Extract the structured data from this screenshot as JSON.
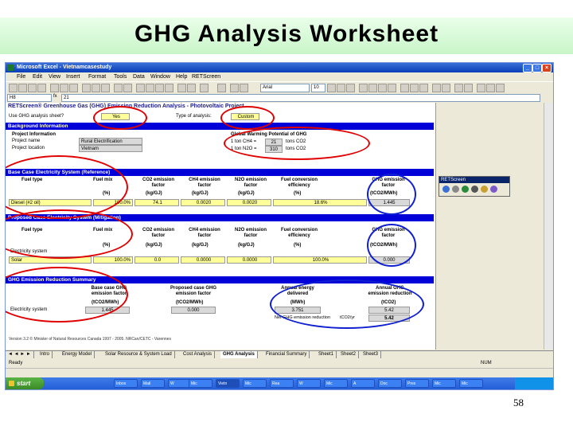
{
  "slide": {
    "title": "GHG Analysis Worksheet",
    "page_number": "58"
  },
  "window": {
    "title": "Microsoft Excel - Vietnamcasestudy"
  },
  "menu": [
    "File",
    "Edit",
    "View",
    "Insert",
    "Format",
    "Tools",
    "Data",
    "Window",
    "Help",
    "RETScreen"
  ],
  "toolbar": {
    "font_name": "Arial",
    "font_size": "10"
  },
  "formula_bar": {
    "name_box": "H8",
    "fx": "fx",
    "value": "21"
  },
  "header": {
    "title": "RETScreen® Greenhouse Gas (GHG) Emission Reduction Analysis - Photovoltaic Project"
  },
  "top_row": {
    "use_label": "Use GHG analysis sheet?",
    "use_value": "Yes",
    "type_label": "Type of analysis:",
    "type_value": "Custom"
  },
  "background": {
    "bar": "Background Information",
    "project_information": "Project Information",
    "project_name_label": "Project name",
    "project_name": "Rural Electrification",
    "project_location_label": "Project location",
    "project_location": "Vietnam",
    "gwp_title": "Global Warming Potential of GHG",
    "gwp_rows": [
      {
        "prefix": "1 ton CH4 =",
        "value": "21",
        "suffix": "tons CO2"
      },
      {
        "prefix": "1 ton N2O =",
        "value": "310",
        "suffix": "tons CO2"
      }
    ]
  },
  "base_case": {
    "bar": "Base Case Electricity System (Reference)",
    "headers": [
      "Fuel type",
      "Fuel mix",
      "CO2 emission factor",
      "CH4 emission factor",
      "N2O emission factor",
      "Fuel conversion efficiency",
      "GHG emission factor"
    ],
    "units": [
      "",
      "(%)",
      "(kg/GJ)",
      "(kg/GJ)",
      "(kg/GJ)",
      "(%)",
      "(tCO2/MWh)"
    ],
    "row": [
      "Diesel (#2 oil)",
      "100.0%",
      "74.1",
      "0.0020",
      "0.0020",
      "18.6%",
      "1.445"
    ]
  },
  "proposed_case": {
    "bar": "Proposed Case Electricity System (Mitigation)",
    "headers": [
      "Fuel type",
      "Fuel mix",
      "CO2 emission factor",
      "CH4 emission factor",
      "N2O emission factor",
      "Fuel conversion efficiency",
      "GHG emission factor"
    ],
    "units": [
      "",
      "(%)",
      "(kg/GJ)",
      "(kg/GJ)",
      "(kg/GJ)",
      "(%)",
      "(tCO2/MWh)"
    ],
    "system_label": "Electricity system",
    "row": [
      "Solar",
      "100.0%",
      "0.0",
      "0.0000",
      "0.0000",
      "100.0%",
      "0.000"
    ]
  },
  "summary": {
    "bar": "GHG Emission Reduction Summary",
    "headers": [
      "Base case GHG emission factor",
      "Proposed case GHG emission factor",
      "Annual energy delivered",
      "Annual GHG emission reduction"
    ],
    "units": [
      "(tCO2/MWh)",
      "(tCO2/MWh)",
      "(MWh)",
      "(tCO2)"
    ],
    "row_label": "Electricity system",
    "row": [
      "1.445",
      "0.000",
      "3.751",
      "5.42"
    ],
    "net_label": "Net GHG emission reduction",
    "net_unit": "tCO2/yr",
    "net_value": "5.42"
  },
  "footer_note": "Version 3.2   © Minister of Natural Resources Canada 1997 - 2005.   NRCan/CETC - Varennes",
  "popup": {
    "title": "RETScreen"
  },
  "sheet_tabs": [
    "Intro",
    "Energy Model",
    "Solar Resource & System Load",
    "Cost Analysis",
    "GHG Analysis",
    "Financial Summary",
    "Sheet1",
    "Sheet2",
    "Sheet3"
  ],
  "active_tab": "GHG Analysis",
  "status": {
    "ready": "Ready",
    "num": "NUM"
  },
  "taskbar": {
    "start": "start",
    "tasks": [
      "Inbox",
      "Mail",
      "W",
      "Mic",
      "Vietn",
      "Mic",
      "Rea",
      "W",
      "Mic",
      "A",
      "Doc",
      "Pres",
      "Mic",
      "Mic"
    ]
  },
  "colors": {
    "section_bar": "#0000D8",
    "input_cell": "#FFFF99",
    "calc_cell": "#D9D9D9",
    "highlight_red": "#E00000",
    "highlight_blue": "#1020D0",
    "title_band": "#C8F5C8"
  }
}
